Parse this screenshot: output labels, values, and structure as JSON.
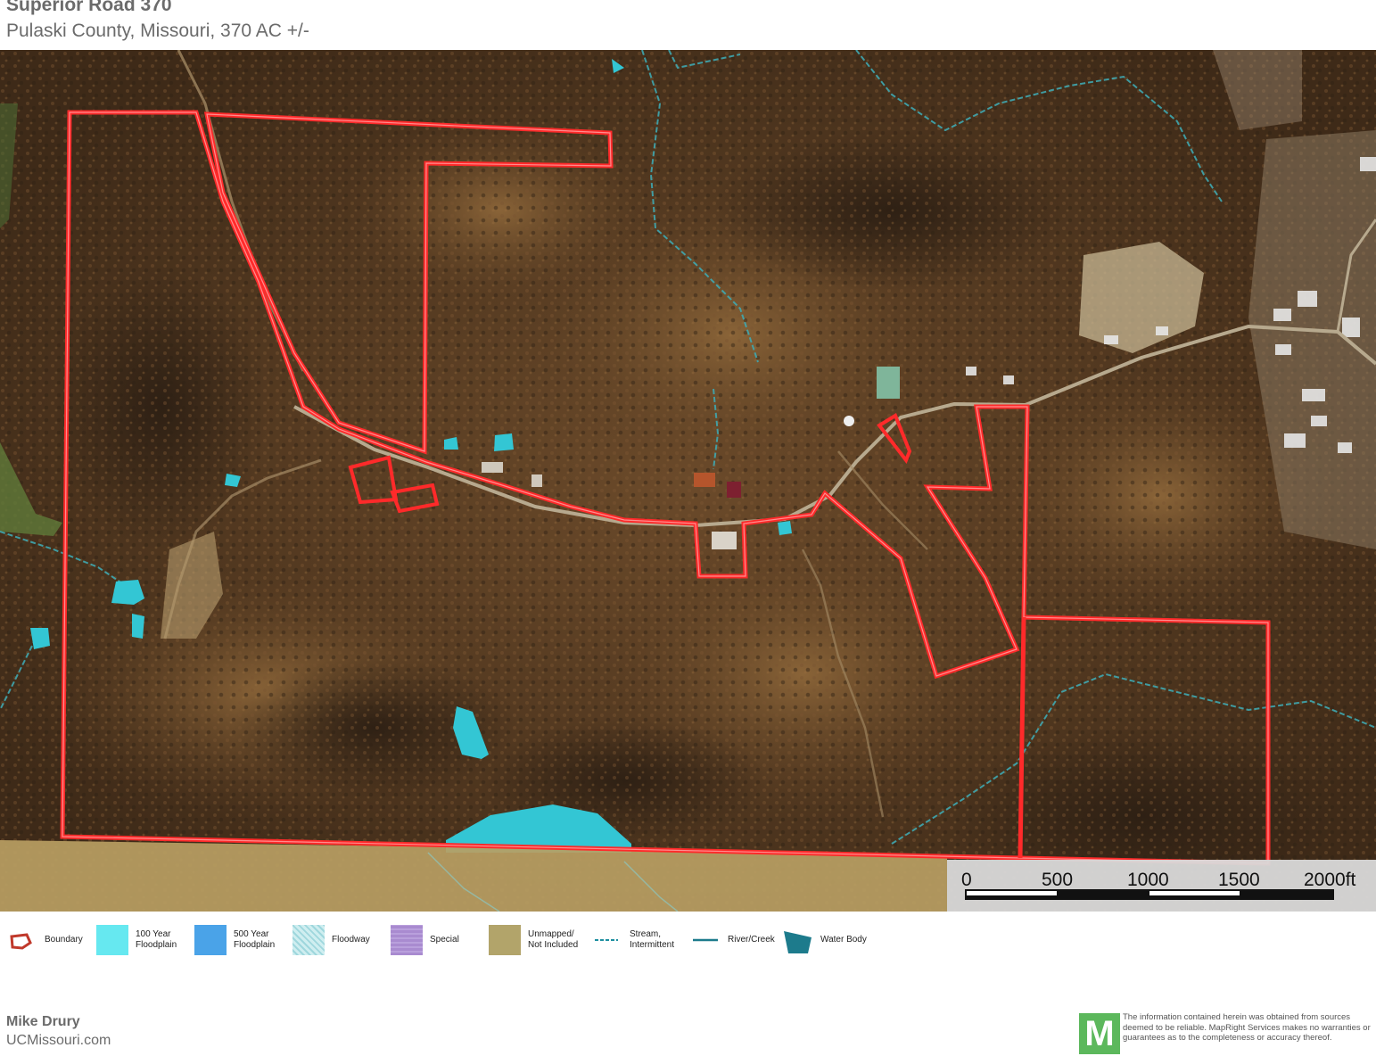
{
  "header": {
    "title": "Superior Road 370",
    "subtitle": "Pulaski County, Missouri, 370 AC +/-"
  },
  "map": {
    "type": "aerial parcel map",
    "boundary_color": "#ff2a2a",
    "floodplain_color": "#33c6d4",
    "stream_color": "#3fa7b0",
    "unmapped_color": "#b89e63",
    "scale": {
      "labels": [
        "0",
        "500",
        "1000",
        "1500",
        "2000ft"
      ]
    }
  },
  "legend": {
    "items": [
      {
        "label": "Boundary",
        "icon": "boundary-icon"
      },
      {
        "label": "100 Year\nFloodplain",
        "color": "#66e8f0"
      },
      {
        "label": "500 Year\nFloodplain",
        "color": "#4aa3e8"
      },
      {
        "label": "Floodway",
        "color": "#bfe3e8"
      },
      {
        "label": "Special",
        "color": "#a98bd0"
      },
      {
        "label": "Unmapped/\nNot Included",
        "color": "#b2a46a"
      },
      {
        "label": "Stream,\nIntermittent",
        "icon": "stream-intermittent-icon"
      },
      {
        "label": "River/Creek",
        "icon": "river-creek-icon"
      },
      {
        "label": "Water Body",
        "color": "#1d7b8c"
      }
    ]
  },
  "footer": {
    "agent_name": "Mike Drury",
    "agent_site": "UCMissouri.com",
    "logo_letter": "M",
    "disclaimer": "The information contained herein was obtained from sources deemed to be reliable. MapRight Services makes no warranties or guarantees as to the completeness or accuracy thereof."
  }
}
